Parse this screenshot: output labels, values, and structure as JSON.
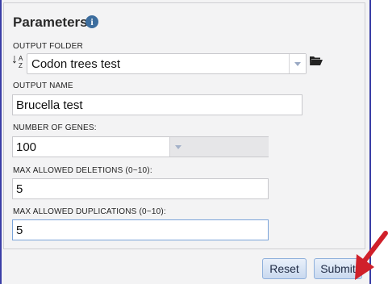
{
  "panel": {
    "title": "Parameters",
    "info_icon": "info-icon",
    "info_glyph": "i"
  },
  "output_folder": {
    "label": "OUTPUT FOLDER",
    "sort_icon_text": "A Z",
    "value": "Codon trees test"
  },
  "output_name": {
    "label": "OUTPUT NAME",
    "value": "Brucella test"
  },
  "genes": {
    "label": "NUMBER OF GENES:",
    "value": "100"
  },
  "deletions": {
    "label": "MAX ALLOWED DELETIONS (0~10):",
    "value": "5"
  },
  "duplications": {
    "label": "MAX ALLOWED DUPLICATIONS (0~10):",
    "value": "5"
  },
  "buttons": {
    "reset": "Reset",
    "submit": "Submit"
  },
  "colors": {
    "frame_border": "#3a3ea6",
    "button_border": "#8fb0dc",
    "annotation_arrow": "#d0202a",
    "info_icon": "#3c6d9e"
  }
}
